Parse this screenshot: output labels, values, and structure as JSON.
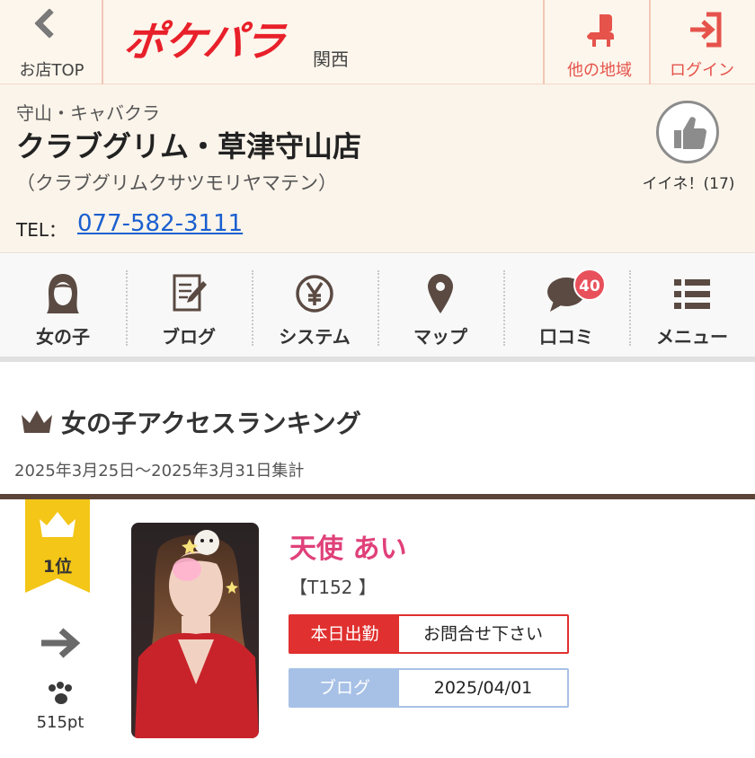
{
  "header": {
    "back_label": "お店TOP",
    "logo_text": "ポケパラ",
    "region": "関西",
    "other_area_label": "他の地域",
    "login_label": "ログイン"
  },
  "shop": {
    "category": "守山・キャバクラ",
    "name": "クラブグリム・草津守山店",
    "kana": "（クラブグリムクサツモリヤマテン）",
    "tel_label": "TEL：",
    "tel": "077-582-3111",
    "like_label": "イイネ！(17)"
  },
  "nav": {
    "items": [
      {
        "label": "女の子",
        "icon": "girl-icon"
      },
      {
        "label": "ブログ",
        "icon": "blog-icon"
      },
      {
        "label": "システム",
        "icon": "yen-icon"
      },
      {
        "label": "マップ",
        "icon": "map-pin-icon"
      },
      {
        "label": "口コミ",
        "icon": "chat-bubble-icon",
        "badge": "40"
      },
      {
        "label": "メニュー",
        "icon": "menu-list-icon"
      }
    ]
  },
  "ranking": {
    "title": "女の子アクセスランキング",
    "period": "2025年3月25日～2025年3月31日集計",
    "entries": [
      {
        "rank": "1位",
        "trend": "arrow-right-icon",
        "points": "515pt",
        "name": "天使 あい",
        "size": "【T152 】",
        "work_label": "本日出勤",
        "work_value": "お問合せ下さい",
        "blog_label": "ブログ",
        "blog_date": "2025/04/01"
      }
    ]
  },
  "colors": {
    "brand_red": "#e8202a",
    "accent_red": "#e5534b",
    "name_pink": "#e0407a",
    "rank_gold": "#f3c617",
    "rule_brown": "#5c4536",
    "link_blue": "#1a5fd0",
    "blog_blue": "#a7c1e6"
  }
}
